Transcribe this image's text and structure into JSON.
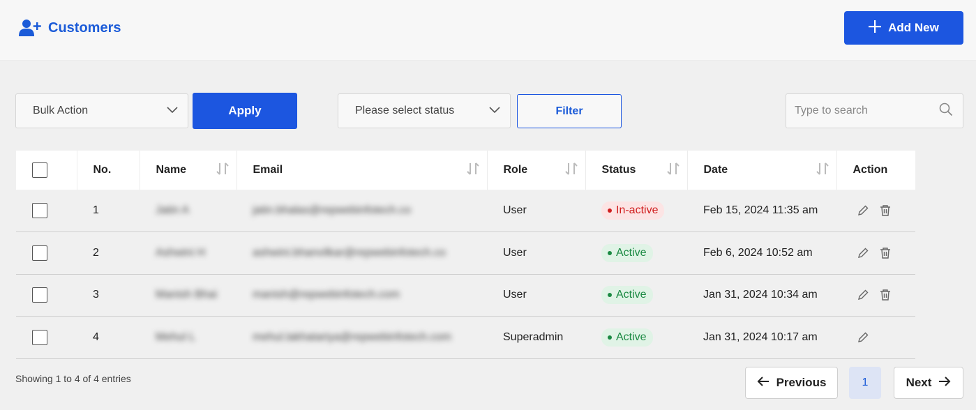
{
  "header": {
    "title": "Customers",
    "title_icon": "user-plus-icon",
    "add_new_label": "Add New"
  },
  "toolbar": {
    "bulk_action": {
      "selected": "Bulk Action"
    },
    "apply_label": "Apply",
    "status_filter": {
      "placeholder": "Please select status"
    },
    "filter_label": "Filter",
    "search": {
      "placeholder": "Type to search",
      "value": ""
    }
  },
  "table": {
    "columns": [
      "No.",
      "Name",
      "Email",
      "Role",
      "Status",
      "Date",
      "Action"
    ],
    "rows": [
      {
        "no": "1",
        "name": "Jatin A",
        "email": "jatin.bhalas@repwebinfotech.co",
        "role": "User",
        "status": "In-active",
        "date": "Feb 15, 2024 11:35 am"
      },
      {
        "no": "2",
        "name": "Ashwini H",
        "email": "ashwini.bhanvilkar@repwebinfotech.co",
        "role": "User",
        "status": "Active",
        "date": "Feb 6, 2024 10:52 am"
      },
      {
        "no": "3",
        "name": "Manish Bhai",
        "email": "manish@repwebinfotech.com",
        "role": "User",
        "status": "Active",
        "date": "Jan 31, 2024 10:34 am"
      },
      {
        "no": "4",
        "name": "Mehul L",
        "email": "mehul.lakhatariya@repwebinfotech.com",
        "role": "Superadmin",
        "status": "Active",
        "date": "Jan 31, 2024 10:17 am"
      }
    ]
  },
  "footer": {
    "showing": "Showing 1 to 4 of 4 entries",
    "previous_label": "Previous",
    "next_label": "Next",
    "current_page": "1"
  },
  "colors": {
    "primary": "#1c56e0",
    "inactive": "#d01f1f",
    "active": "#1b8a43"
  }
}
